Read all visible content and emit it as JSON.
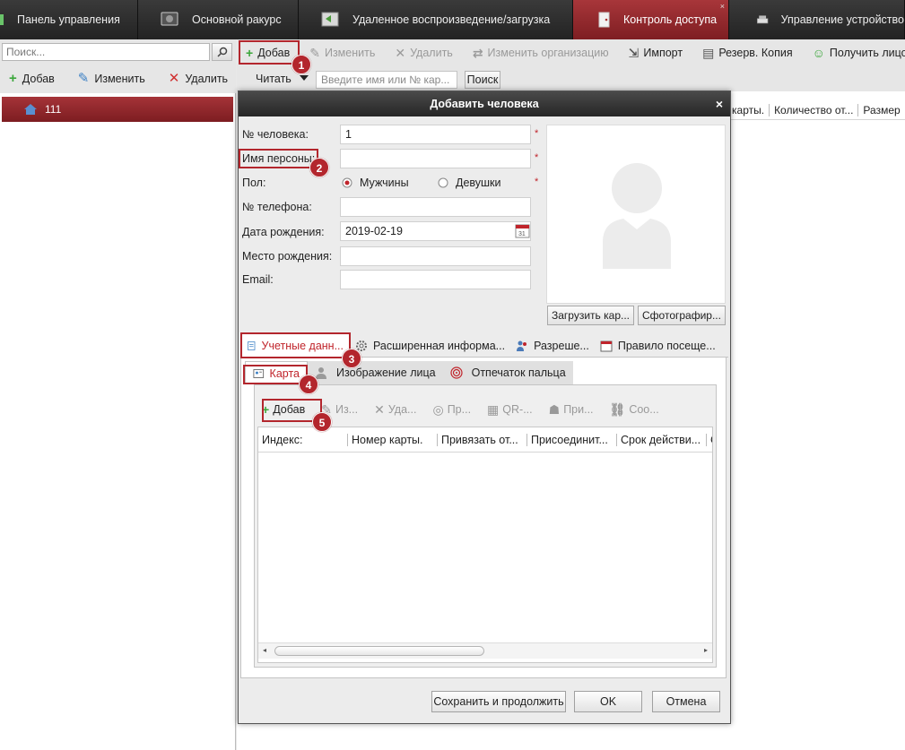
{
  "top_tabs": [
    {
      "label": "Панель управления",
      "icon": "dashboard-icon"
    },
    {
      "label": "Основной ракурс",
      "icon": "camera-view-icon"
    },
    {
      "label": "Удаленное воспроизведение/загрузка",
      "icon": "remote-playback-icon"
    },
    {
      "label": "Контроль доступа",
      "icon": "door-access-icon",
      "active": true
    },
    {
      "label": "Управление устройство",
      "icon": "device-manage-icon"
    }
  ],
  "left_panel": {
    "search_placeholder": "Поиск...",
    "add_label": "Добав",
    "edit_label": "Изменить",
    "delete_label": "Удалить",
    "tree_item": "111"
  },
  "right_toolbar": {
    "add": "Добав",
    "edit": "Изменить",
    "delete": "Удалить",
    "change_org": "Изменить организацию",
    "import": "Импорт",
    "backup": "Резерв. Копия",
    "get_face": "Получить лицо"
  },
  "right_search": {
    "read_label": "Читать",
    "placeholder": "Введите имя или № кар...",
    "search_btn": "Поиск"
  },
  "right_columns": [
    "карты.",
    "Количество от...",
    "Размер"
  ],
  "modal": {
    "title": "Добавить человека",
    "close": "×",
    "fields": {
      "person_no_label": "№ человека:",
      "person_no_value": "1",
      "name_label": "Имя персоны:",
      "name_value": "",
      "gender_label": "Пол:",
      "male_label": "Мужчины",
      "female_label": "Девушки",
      "phone_label": "№ телефона:",
      "phone_value": "",
      "birth_label": "Дата рождения:",
      "birth_value": "2019-02-19",
      "birthplace_label": "Место рождения:",
      "birthplace_value": "",
      "email_label": "Email:",
      "email_value": "",
      "required_mark": "*"
    },
    "upload_btn": "Загрузить кар...",
    "capture_btn": "Сфотографир...",
    "tabs": [
      "Учетные данн...",
      "Расширенная информа...",
      "Разреше...",
      "Правило посеще..."
    ],
    "subtabs": [
      "Карта",
      "Изображение лица",
      "Отпечаток пальца"
    ],
    "inner_toolbar": [
      "Добав",
      "Из...",
      "Уда...",
      "Пр...",
      "QR-...",
      "При...",
      "Соо..."
    ],
    "grid_columns": [
      "Индекс:",
      "Номер карты.",
      "Привязать от...",
      "Присоединит...",
      "Срок действи...",
      "С"
    ],
    "save_continue": "Сохранить и продолжить",
    "ok": "OK",
    "cancel": "Отмена"
  },
  "annotations": [
    "1",
    "2",
    "3",
    "4",
    "5"
  ],
  "colors": {
    "accent": "#b3262d",
    "active_tab": "#9a2c30",
    "toolbar_bg": "#e6e6e6"
  }
}
